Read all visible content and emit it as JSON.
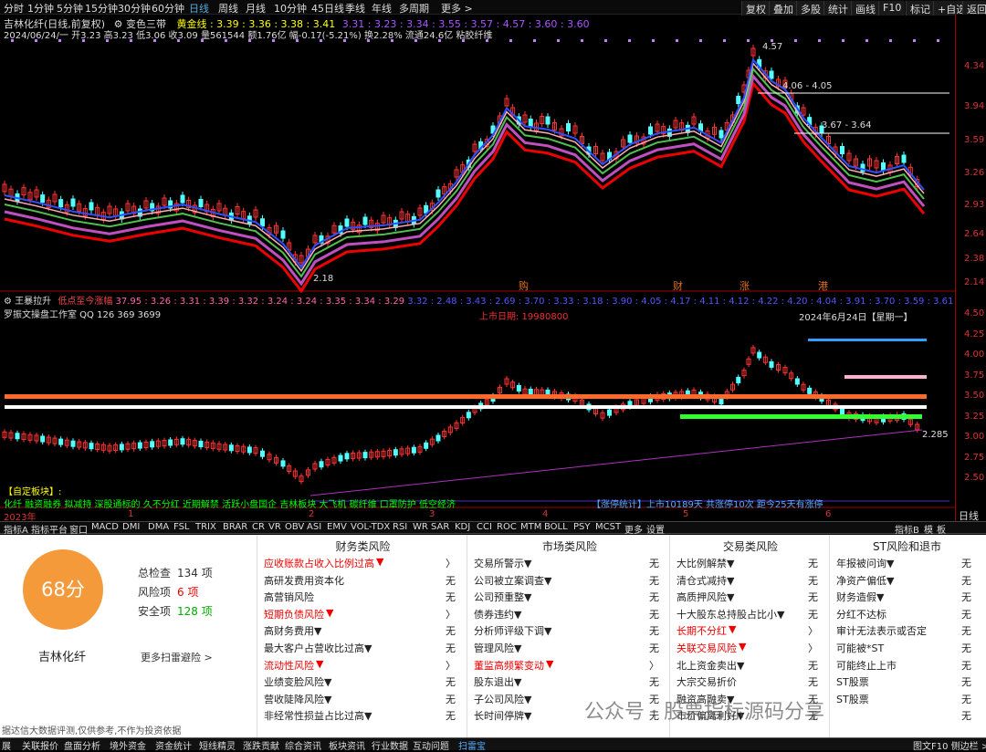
{
  "topbar": {
    "periods": [
      "分时",
      "1分钟",
      "5分钟",
      "15分钟",
      "30分钟",
      "60分钟",
      "日线",
      "周线",
      "月线",
      "10分钟",
      "45日线",
      "季线",
      "年线",
      "多周期",
      "更多 >"
    ],
    "right_buttons": [
      "复权",
      "叠加",
      "多股",
      "统计",
      "画线",
      "F10",
      "标记",
      "+自选",
      "返回"
    ]
  },
  "main_chart": {
    "title": "吉林化纤(日线,前复权)",
    "indicator": "变色三带",
    "ma_label": "黄金线",
    "ma_values": ": 3.39 : 3.36 : 3.38 : 3.41",
    "ma_values2": "3.31 : 3.23 : 3.34 : 3.55 : 3.57 : 4.57 : 3.60 : 3.60",
    "info_line": "2024/06/24/一 开3.23 高3.23 低3.06 收3.09 量561544 额1.76亿 幅-0.17(-5.21%) 换2.28% 流通24.6亿 粘胶纤维",
    "labels": {
      "high": "4.57",
      "low": "2.18",
      "band1": "4.06 - 4.05",
      "band2": "3.67 - 3.64"
    },
    "events": [
      "购",
      "财",
      "涨",
      "港"
    ],
    "yticks": [
      "4.34",
      "3.94",
      "3.59",
      "3.26",
      "2.93",
      "2.64",
      "2.38",
      "2.14"
    ]
  },
  "sub_chart": {
    "title": "王暴拉升",
    "subtitle": "低点至今涨幅",
    "values": "37.95 : 3.26 : 3.31 : 3.39 : 3.32 : 3.24 : 3.24 : 3.35 : 3.34 : 3.29",
    "values2": "3.32 : 2.48 : 3.43 : 2.69 : 3.70 : 3.33 : 3.18 : 3.90 : 4.05 : 4.17 : 4.11 : 4.12 : 4.22 : 4.20 : 4.04 : 3.91 : 3.70 : 3.59 : 3.61 : 3.71 : 3",
    "studio": "罗振文操盘工作室 QQ 126 369 3699",
    "listing": "上市日期: 19980800",
    "date_label": "2024年6月24日【星期一】",
    "low_label": "2.285",
    "yticks": [
      "4.50",
      "4.25",
      "4.00",
      "3.75",
      "3.50",
      "3.25",
      "3.00",
      "2.75",
      "2.50"
    ],
    "custom_block": "【自定板块】:",
    "tags": "化纤 融资融券 拟减持 深股通标的 久不分红 近期解禁 活跃小盘国企 吉林板块 大飞机 碳纤维 口罩防护 低空经济",
    "stats": "【涨停统计】上市10189天   共涨停10次   距今25天有涨停",
    "x_labels": [
      "2023年",
      "1",
      "2",
      "3",
      "4",
      "5",
      "6"
    ]
  },
  "tabbar": {
    "tabs": [
      "指标A",
      "指标平台",
      "窗口",
      "MACD",
      "DMI",
      "DMA",
      "FSL",
      "TRIX",
      "BRAR",
      "CR",
      "VR",
      "OBV",
      "ASI",
      "EMV",
      "VOL-TDX",
      "RSI",
      "WR",
      "SAR",
      "KDJ",
      "CCI",
      "ROC",
      "MTM",
      "BOLL",
      "PSY",
      "MCST",
      "更多",
      "设置"
    ],
    "right": [
      "指标B",
      "模",
      "板"
    ]
  },
  "panel": {
    "score": "68分",
    "stock_name": "吉林化纤",
    "summary": [
      {
        "label": "总检查",
        "value": "134 项"
      },
      {
        "label": "风险项",
        "value": "6 项"
      },
      {
        "label": "安全项",
        "value": "128 项"
      }
    ],
    "more_link": "更多扫雷避险 >",
    "columns": [
      {
        "title": "财务类风险",
        "items": [
          {
            "t": "应收账款占收入比例过高",
            "v": "▼",
            "r": true,
            "a": "〉"
          },
          {
            "t": "高研发费用资本化",
            "v": "无"
          },
          {
            "t": "高营销风险",
            "v": "无"
          },
          {
            "t": "短期负债风险",
            "v": "▼",
            "r": true,
            "a": "〉"
          },
          {
            "t": "高财务费用▼",
            "v": "无"
          },
          {
            "t": "最大客户占营收比过高▼",
            "v": "无"
          },
          {
            "t": "流动性风险",
            "v": "▼",
            "r": true,
            "a": "〉"
          },
          {
            "t": "业绩变脸风险▼",
            "v": "无"
          },
          {
            "t": "营收陡降风险▼",
            "v": "无"
          },
          {
            "t": "非经常性损益占比过高▼",
            "v": "无"
          }
        ]
      },
      {
        "title": "市场类风险",
        "items": [
          {
            "t": "交易所警示▼",
            "v": "无"
          },
          {
            "t": "公司被立案调查▼",
            "v": "无"
          },
          {
            "t": "公司预重整▼",
            "v": "无"
          },
          {
            "t": "债券违约▼",
            "v": "无"
          },
          {
            "t": "分析师评级下调▼",
            "v": "无"
          },
          {
            "t": "管理风险▼",
            "v": "无"
          },
          {
            "t": "董监高频繁变动",
            "v": "▼",
            "r": true,
            "a": "〉"
          },
          {
            "t": "股东退出▼",
            "v": "无"
          },
          {
            "t": "子公司风险▼",
            "v": "无"
          },
          {
            "t": "长时间停牌▼",
            "v": "无"
          }
        ]
      },
      {
        "title": "交易类风险",
        "items": [
          {
            "t": "大比例解禁▼",
            "v": "无"
          },
          {
            "t": "清仓式减持▼",
            "v": "无"
          },
          {
            "t": "高质押风险▼",
            "v": "无"
          },
          {
            "t": "十大股东总持股占比小▼",
            "v": "无"
          },
          {
            "t": "长期不分红",
            "v": "▼",
            "r": true,
            "a": "〉"
          },
          {
            "t": "关联交易风险",
            "v": "▼",
            "r": true,
            "a": "〉"
          },
          {
            "t": "北上资金卖出▼",
            "v": "无"
          },
          {
            "t": "大宗交易折价",
            "v": "无"
          },
          {
            "t": "融资高融卖▼",
            "v": "无"
          },
          {
            "t": "市价偏离利好▼",
            "v": "无"
          }
        ]
      },
      {
        "title": "ST风险和退市",
        "items": [
          {
            "t": "年报被问询▼",
            "v": "无"
          },
          {
            "t": "净资产偏低▼",
            "v": "无"
          },
          {
            "t": "财务造假▼",
            "v": "无"
          },
          {
            "t": "分红不达标",
            "v": "无"
          },
          {
            "t": "审计无法表示或否定",
            "v": "无"
          },
          {
            "t": "可能被*ST",
            "v": "无"
          },
          {
            "t": "可能终止上市",
            "v": "无"
          },
          {
            "t": "ST股票",
            "v": "无"
          },
          {
            "t": "ST股票",
            "v": "无"
          },
          {
            "t": "",
            "v": "无"
          }
        ]
      }
    ],
    "disclaimer": "据达信大数据评测,仅供参考,不作为投资依据",
    "watermark": "公众号 · 股票指标源码分享"
  },
  "bottombar": {
    "tabs": [
      "展",
      "关联报价",
      "盘面分析",
      "境外资金",
      "资金统计",
      "短线精灵",
      "涨跌贡献",
      "综合资讯",
      "板块资讯",
      "行业数据",
      "互动问题",
      "扫雷宝"
    ],
    "right": "图文F10 侧边栏 >"
  },
  "colors": {
    "up": "#ff3232",
    "down": "#54ffff",
    "accent": "#f49a3b"
  }
}
